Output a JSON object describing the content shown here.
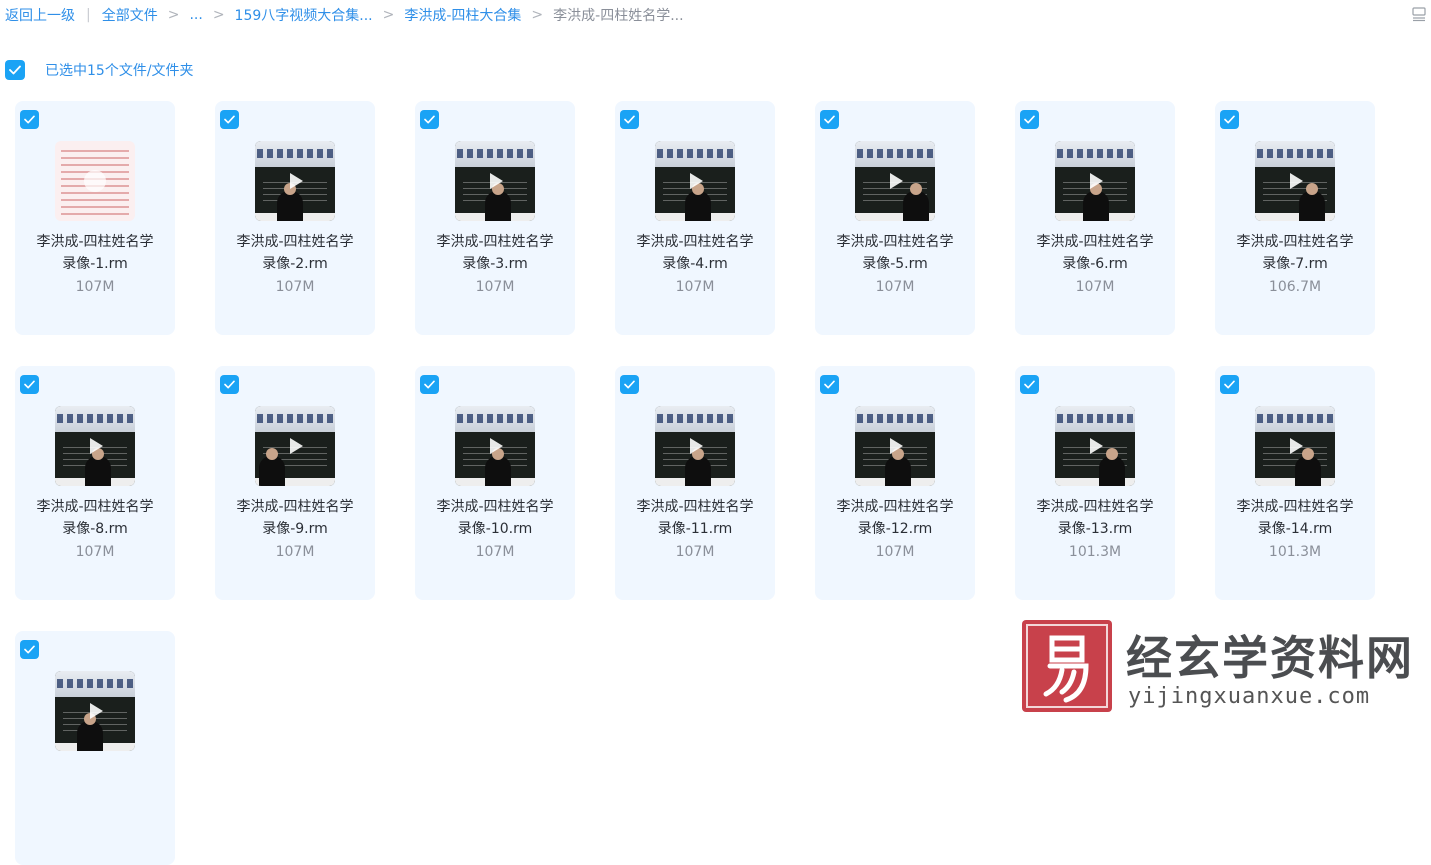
{
  "breadcrumb": {
    "back": "返回上一级",
    "all_files": "全部文件",
    "ellipsis": "...",
    "folder1": "159八字视频大合集...",
    "folder2": "李洪成-四柱大合集",
    "current": "李洪成-四柱姓名学..."
  },
  "selection": {
    "label": "已选中15个文件/文件夹"
  },
  "files": [
    {
      "name_line1": "李洪成-四柱姓名学",
      "name_line2": "录像-1.rm",
      "size": "107M"
    },
    {
      "name_line1": "李洪成-四柱姓名学",
      "name_line2": "录像-2.rm",
      "size": "107M"
    },
    {
      "name_line1": "李洪成-四柱姓名学",
      "name_line2": "录像-3.rm",
      "size": "107M"
    },
    {
      "name_line1": "李洪成-四柱姓名学",
      "name_line2": "录像-4.rm",
      "size": "107M"
    },
    {
      "name_line1": "李洪成-四柱姓名学",
      "name_line2": "录像-5.rm",
      "size": "107M"
    },
    {
      "name_line1": "李洪成-四柱姓名学",
      "name_line2": "录像-6.rm",
      "size": "107M"
    },
    {
      "name_line1": "李洪成-四柱姓名学",
      "name_line2": "录像-7.rm",
      "size": "106.7M"
    },
    {
      "name_line1": "李洪成-四柱姓名学",
      "name_line2": "录像-8.rm",
      "size": "107M"
    },
    {
      "name_line1": "李洪成-四柱姓名学",
      "name_line2": "录像-9.rm",
      "size": "107M"
    },
    {
      "name_line1": "李洪成-四柱姓名学",
      "name_line2": "录像-10.rm",
      "size": "107M"
    },
    {
      "name_line1": "李洪成-四柱姓名学",
      "name_line2": "录像-11.rm",
      "size": "107M"
    },
    {
      "name_line1": "李洪成-四柱姓名学",
      "name_line2": "录像-12.rm",
      "size": "107M"
    },
    {
      "name_line1": "李洪成-四柱姓名学",
      "name_line2": "录像-13.rm",
      "size": "101.3M"
    },
    {
      "name_line1": "李洪成-四柱姓名学",
      "name_line2": "录像-14.rm",
      "size": "101.3M"
    },
    {
      "name_line1": "",
      "name_line2": "",
      "size": ""
    }
  ],
  "watermark": {
    "title": "经玄学资料网",
    "url": "yijingxuanxue.com"
  },
  "colors": {
    "accent": "#1aa3f5",
    "link": "#2f8fe8",
    "card_bg": "#f0f7ff",
    "seal": "#c8414b"
  },
  "icons": {
    "checkbox": "check-icon",
    "play": "play-icon",
    "view_toggle": "list-view-icon"
  }
}
